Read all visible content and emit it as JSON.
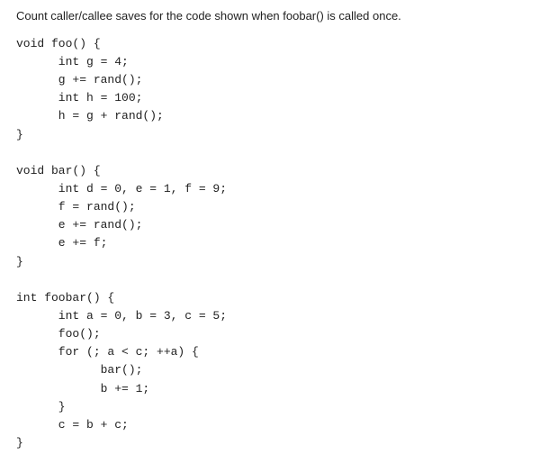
{
  "prompt": "Count caller/callee saves for the code shown when foobar() is called once.",
  "code": "void foo() {\n      int g = 4;\n      g += rand();\n      int h = 100;\n      h = g + rand();\n}\n\nvoid bar() {\n      int d = 0, e = 1, f = 9;\n      f = rand();\n      e += rand();\n      e += f;\n}\n\nint foobar() {\n      int a = 0, b = 3, c = 5;\n      foo();\n      for (; a < c; ++a) {\n            bar();\n            b += 1;\n      }\n      c = b + c;\n}"
}
